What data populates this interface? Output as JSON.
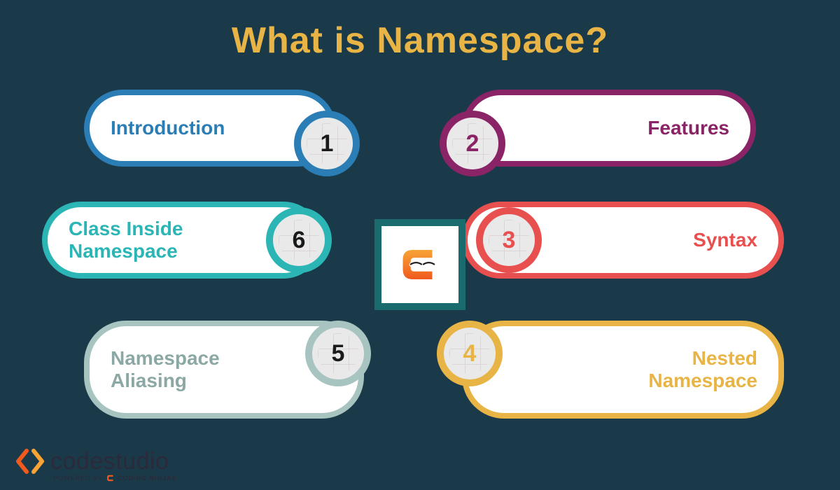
{
  "title": "What is Namespace?",
  "items": {
    "i1": {
      "num": "1",
      "label": "Introduction"
    },
    "i2": {
      "num": "2",
      "label": "Features"
    },
    "i3": {
      "num": "3",
      "label": "Syntax"
    },
    "i4": {
      "num": "4",
      "label": "Nested Namespace"
    },
    "i5": {
      "num": "5",
      "label": "Namespace Aliasing"
    },
    "i6": {
      "num": "6",
      "label": "Class Inside Namespace"
    }
  },
  "footer": {
    "brand_part1": "code",
    "brand_part2": "studio",
    "powered_by": "POWERED BY",
    "partner": "CODING NINJAS"
  },
  "colors": {
    "bg": "#1a3a4a",
    "title": "#e8b445",
    "c1": "#2b7db5",
    "c2": "#8a2466",
    "c3": "#e85050",
    "c4": "#e8b445",
    "c5": "#a8c4c0",
    "c6": "#2bb5b5"
  }
}
